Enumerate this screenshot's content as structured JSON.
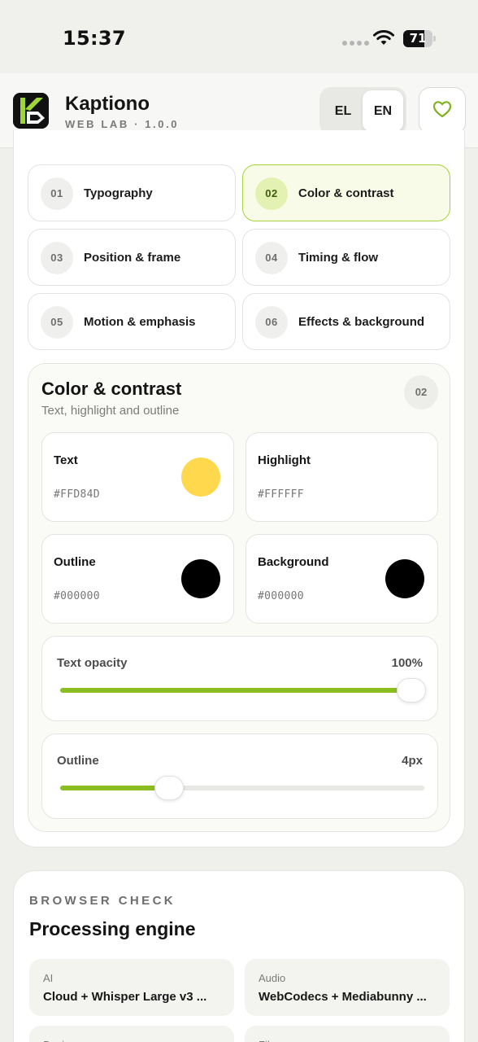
{
  "status_bar": {
    "time": "15:37",
    "battery": "71",
    "battery_level": 0.71
  },
  "header": {
    "app_name": "Kaptiono",
    "subtitle": "WEB LAB · 1.0.0",
    "languages": [
      "EL",
      "EN"
    ],
    "selected_language": "EN",
    "favorite_icon": "heart-icon",
    "accent_color": "#8bbd23"
  },
  "tabs": [
    {
      "num": "01",
      "label": "Typography",
      "active": false
    },
    {
      "num": "02",
      "label": "Color & contrast",
      "active": true
    },
    {
      "num": "03",
      "label": "Position & frame",
      "active": false
    },
    {
      "num": "04",
      "label": "Timing & flow",
      "active": false
    },
    {
      "num": "05",
      "label": "Motion & emphasis",
      "active": false
    },
    {
      "num": "06",
      "label": "Effects & background",
      "active": false
    }
  ],
  "section": {
    "title": "Color & contrast",
    "subtitle": "Text, highlight and outline",
    "badge": "02",
    "swatches": [
      {
        "name": "Text",
        "hex": "#FFD84D",
        "color": "#FFD84D"
      },
      {
        "name": "Highlight",
        "hex": "#FFFFFF",
        "color": "#FFFFFF"
      },
      {
        "name": "Outline",
        "hex": "#000000",
        "color": "#000000"
      },
      {
        "name": "Background",
        "hex": "#000000",
        "color": "#000000"
      }
    ],
    "sliders": [
      {
        "label": "Text opacity",
        "value": "100%",
        "fraction": 1.0
      },
      {
        "label": "Outline",
        "value": "4px",
        "fraction": 0.3
      }
    ]
  },
  "browser_check": {
    "eyebrow": "BROWSER CHECK",
    "title": "Processing engine",
    "items": [
      {
        "key": "AI",
        "value": "Cloud + Whisper Large v3 ..."
      },
      {
        "key": "Audio",
        "value": "WebCodecs + Mediabunny ..."
      },
      {
        "key": "Device",
        "value": ""
      },
      {
        "key": "File",
        "value": ""
      }
    ]
  }
}
